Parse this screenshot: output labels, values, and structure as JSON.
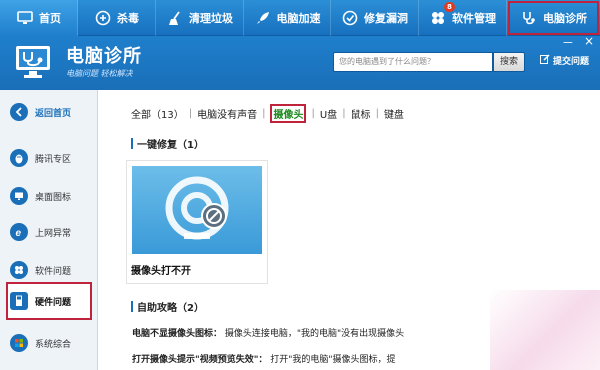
{
  "topbar": {
    "tabs": [
      {
        "label": "首页",
        "icon": "monitor-icon"
      },
      {
        "label": "杀毒",
        "icon": "shield-icon"
      },
      {
        "label": "清理垃圾",
        "icon": "broom-icon"
      },
      {
        "label": "电脑加速",
        "icon": "rocket-icon"
      },
      {
        "label": "修复漏洞",
        "icon": "patch-icon"
      },
      {
        "label": "软件管理",
        "icon": "apps-icon",
        "badge": "8"
      },
      {
        "label": "电脑诊所",
        "icon": "stethoscope-icon"
      }
    ]
  },
  "header": {
    "title": "电脑诊所",
    "subtitle": "电脑问题 轻松解决",
    "search_placeholder": "您的电脑遇到了什么问题？",
    "search_button": "搜索",
    "submit_label": "提交问题",
    "minimize": "－",
    "close": "×"
  },
  "sidebar": {
    "items": [
      {
        "label": "返回首页",
        "icon": "back-arrow-icon"
      },
      {
        "label": "腾讯专区",
        "icon": "penguin-icon"
      },
      {
        "label": "桌面图标",
        "icon": "desktop-icon"
      },
      {
        "label": "上网异常",
        "icon": "ie-icon"
      },
      {
        "label": "软件问题",
        "icon": "software-icon"
      },
      {
        "label": "硬件问题",
        "icon": "usb-icon"
      },
      {
        "label": "系统综合",
        "icon": "windows-icon"
      }
    ]
  },
  "main": {
    "filters": {
      "all": "全部（13）",
      "f1": "电脑没有声音",
      "f2": "摄像头",
      "f3": "U盘",
      "f4": "鼠标",
      "f5": "键盘"
    },
    "quickfix_title": "一键修复（1）",
    "card_label": "摄像头打不开",
    "guide_title": "自助攻略（2）",
    "guide_rows": [
      {
        "title": "电脑不显摄像头图标：",
        "text": "摄像头连接电脑，\"我的电脑\"没有出现摄像头"
      },
      {
        "title": "打开摄像头提示\"视频预览失效\"：",
        "text": "打开\"我的电脑\"摄像头图标，提"
      }
    ]
  },
  "colors": {
    "accent": "#1a6fb8",
    "highlight": "#c0233c",
    "active_filter": "#1f8a20"
  }
}
